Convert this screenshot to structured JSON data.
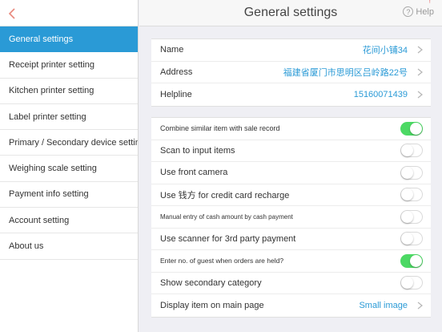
{
  "header": {
    "title": "General settings",
    "help_label": "Help"
  },
  "sidebar": {
    "items": [
      {
        "label": "General settings",
        "active": true
      },
      {
        "label": "Receipt printer setting",
        "active": false
      },
      {
        "label": "Kitchen printer setting",
        "active": false
      },
      {
        "label": "Label printer setting",
        "active": false
      },
      {
        "label": "Primary / Secondary device setting",
        "active": false
      },
      {
        "label": "Weighing scale setting",
        "active": false
      },
      {
        "label": "Payment info setting",
        "active": false
      },
      {
        "label": "Account setting",
        "active": false
      },
      {
        "label": "About us",
        "active": false
      }
    ]
  },
  "store": {
    "name_label": "Name",
    "name_value": "花间小铺34",
    "address_label": "Address",
    "address_value": "福建省厦门市思明区吕岭路22号",
    "helpline_label": "Helpline",
    "helpline_value": "15160071439"
  },
  "options": [
    {
      "label": "Combine similar item with sale record",
      "enabled": true
    },
    {
      "label": "Scan to input items",
      "enabled": false
    },
    {
      "label": "Use front camera",
      "enabled": false
    },
    {
      "label": "Use 钱方 for credit card recharge",
      "enabled": false
    },
    {
      "label": "Manual entry of cash amount by cash payment",
      "enabled": false
    },
    {
      "label": "Use scanner for 3rd party payment",
      "enabled": false
    },
    {
      "label": "Enter no. of guest when orders are held?",
      "enabled": true
    },
    {
      "label": "Show secondary category",
      "enabled": false
    }
  ],
  "display_item": {
    "label": "Display item on main page",
    "value": "Small image"
  },
  "colors": {
    "accent": "#2a9ad6",
    "toggle_on": "#4cd964"
  }
}
